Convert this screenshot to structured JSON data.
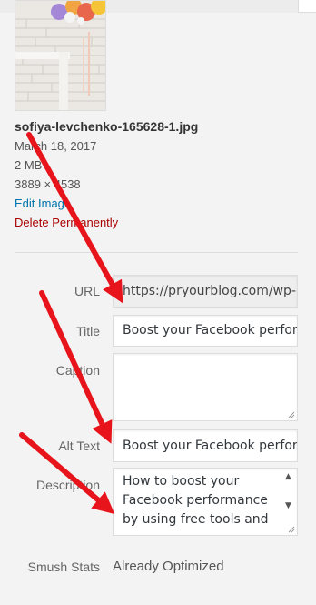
{
  "attachment": {
    "filename": "sofiya-levchenko-165628-1.jpg",
    "date": "March 18, 2017",
    "filesize": "2 MB",
    "dimensions": "3889 × 4538",
    "edit_link": "Edit Image",
    "delete_link": "Delete Permanently"
  },
  "fields": {
    "url": {
      "label": "URL",
      "value": "https://pryourblog.com/wp-"
    },
    "title": {
      "label": "Title",
      "value": "Boost your Facebook perfor"
    },
    "caption": {
      "label": "Caption",
      "value": ""
    },
    "alt_text": {
      "label": "Alt Text",
      "value": "Boost your Facebook perfor"
    },
    "description": {
      "label": "Description",
      "lines": [
        "How to boost your",
        "Facebook performance",
        "by using free tools and"
      ]
    },
    "smush": {
      "label": "Smush Stats",
      "value": "Already Optimized"
    }
  },
  "colors": {
    "link": "#0073aa",
    "delete": "#a00000",
    "annotation_arrow": "#e8141b"
  },
  "icons": {
    "resize_grip": "resize-grip-icon",
    "scroll_up": "scroll-up-icon",
    "scroll_down": "scroll-down-icon"
  }
}
